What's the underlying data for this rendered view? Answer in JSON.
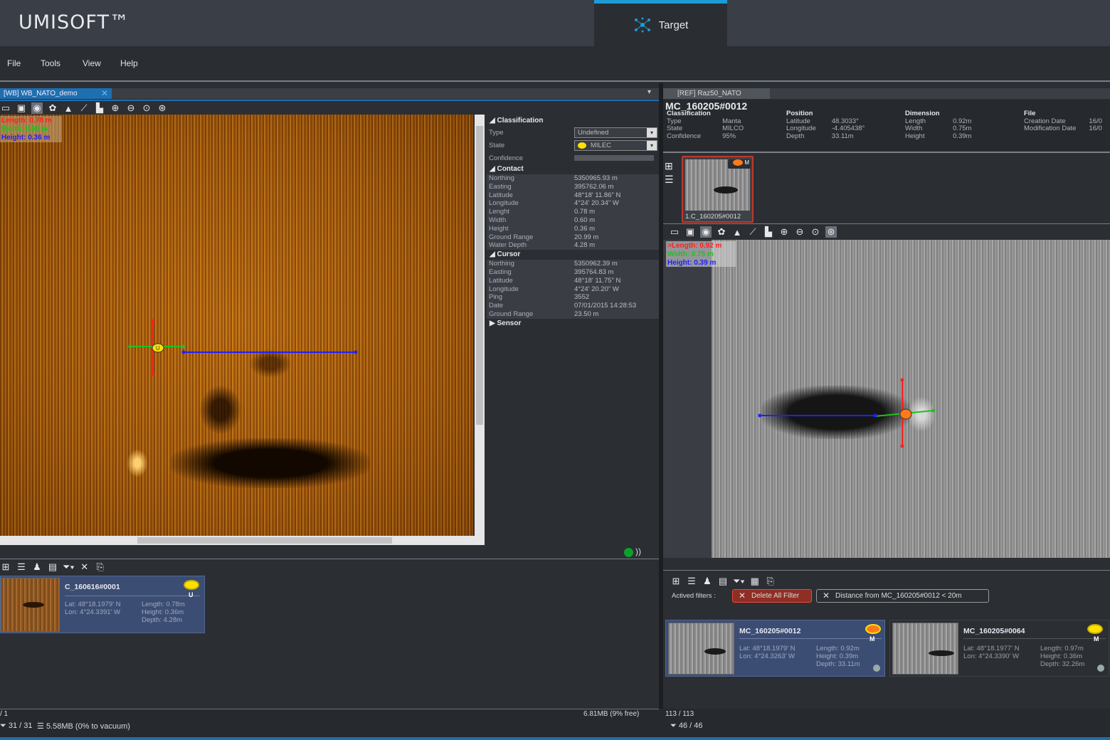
{
  "app": {
    "title": "UMISOFT™",
    "active_tab": "Target"
  },
  "menu": [
    "File",
    "Tools",
    "View",
    "Help"
  ],
  "left_tab": {
    "label": "[WB] WB_NATO_demo"
  },
  "right_tab": {
    "label": "[REF] Raz50_NATO"
  },
  "left_measure": {
    "length": "Length: 0.78 m",
    "width": "Width: 0.60 m",
    "height": "Height: 0.36 m"
  },
  "properties": {
    "classification": {
      "header": "Classification",
      "type_label": "Type",
      "type_value": "Undefined",
      "state_label": "State",
      "state_value": "MILEC",
      "confidence_label": "Confidence"
    },
    "contact": {
      "header": "Contact",
      "rows": [
        {
          "k": "Northing",
          "v": "5350965.93 m"
        },
        {
          "k": "Easting",
          "v": "395762.06 m"
        },
        {
          "k": "Latitude",
          "v": "48°18' 11.86\" N"
        },
        {
          "k": "Longitude",
          "v": "4°24' 20.34\" W"
        },
        {
          "k": "Lenght",
          "v": "0.78 m"
        },
        {
          "k": "Width",
          "v": "0.60 m"
        },
        {
          "k": "Height",
          "v": "0.36 m"
        },
        {
          "k": "Ground Range",
          "v": "20.99 m"
        },
        {
          "k": "Water Depth",
          "v": "4.28 m"
        }
      ]
    },
    "cursor": {
      "header": "Cursor",
      "rows": [
        {
          "k": "Northing",
          "v": "5350962.39 m"
        },
        {
          "k": "Easting",
          "v": "395764.83 m"
        },
        {
          "k": "Latitude",
          "v": "48°18' 11.75\" N"
        },
        {
          "k": "Longitude",
          "v": "4°24' 20.20\" W"
        },
        {
          "k": "Ping",
          "v": "3552"
        },
        {
          "k": "Date",
          "v": "07/01/2015 14:28:53"
        },
        {
          "k": "Ground Range",
          "v": "23.50 m"
        }
      ]
    },
    "sensor": {
      "header": "Sensor"
    }
  },
  "left_card": {
    "name": "C_160616#0001",
    "lat": "Lat: 48°18.1979' N",
    "lon": "Lon: 4°24.3391' W",
    "length": "Length: 0.78m",
    "height": "Height: 0.36m",
    "depth": "Depth: 4.28m",
    "badge": "U"
  },
  "ref": {
    "title": "MC_160205#0012",
    "classification": {
      "header": "Classification",
      "labels": [
        "Type",
        "State",
        "Confidence"
      ],
      "values": [
        "Manta",
        "MILCO",
        "95%"
      ]
    },
    "position": {
      "header": "Position",
      "labels": [
        "Latitude",
        "Longitude",
        "Depth"
      ],
      "values": [
        "48.3033°",
        "-4.405438°",
        "33.11m"
      ]
    },
    "dimension": {
      "header": "Dimension",
      "labels": [
        "Length",
        "Width",
        "Height"
      ],
      "values": [
        "0.92m",
        "0.75m",
        "0.39m"
      ]
    },
    "file": {
      "header": "File",
      "labels": [
        "Creation Date",
        "Modification Date"
      ],
      "values": [
        "16/0",
        "16/0"
      ]
    },
    "thumb_label": "1.C_160205#0012",
    "thumb_badge": "M"
  },
  "right_measure": {
    "length": ">Length: 0.92 m",
    "width": "Width: 0.75 m",
    "height": "Height: 0.39 m"
  },
  "filters": {
    "label": "Actived filters :",
    "delete_all": "Delete All Filter",
    "distance": "Distance from MC_160205#0012 < 20m"
  },
  "right_cards": [
    {
      "name": "MC_160205#0012",
      "lat": "Lat: 48°18.1979' N",
      "lon": "Lon: 4°24.3263' W",
      "length": "Length: 0.92m",
      "height": "Height: 0.39m",
      "depth": "Depth: 33.11m",
      "badge": "M"
    },
    {
      "name": "MC_160205#0064",
      "lat": "Lat: 48°18.1977' N",
      "lon": "Lon: 4°24.3390' W",
      "length": "Length: 0.97m",
      "height": "Height: 0.36m",
      "depth": "Depth: 32.26m",
      "badge": "M"
    }
  ],
  "status": {
    "left_count": "/ 1",
    "left_free": "6.81MB (9% free)",
    "left_filter": "31 / 31",
    "left_db": "5.58MB (0% to vacuum)",
    "right_count": "113 / 113",
    "right_filter": "46 / 46"
  },
  "colors": {
    "accent": "#1d9bd7",
    "length": "#ff2020",
    "width": "#20c020",
    "height": "#2020ff",
    "card": "#3c4d73",
    "filter_red": "#c0392b"
  }
}
